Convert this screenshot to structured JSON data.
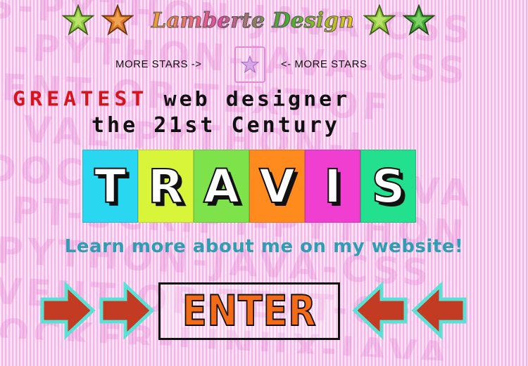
{
  "background": {
    "words": [
      "S-PYTHON-JAVA-CSS",
      "-PYTHON-JAVA-CSS",
      "VENT OR-TEXT-OF",
      "VAL-PYTHON-J",
      "DOCKER-LINUX-JAVA",
      "PT-SCRIPT-PYTHON"
    ]
  },
  "logo": {
    "text": "Lamberte Design",
    "star_colors": [
      "#8fc73e",
      "#d97a2a",
      "#8fc73e",
      "#4aa83a"
    ]
  },
  "more_stars": {
    "left_label": "MORE STARS ->",
    "right_label": "<- MORE STARS",
    "icon": "star-icon"
  },
  "tagline": {
    "highlight": "GREATEST",
    "line1_rest": " web designer",
    "line2": "the 21st Century"
  },
  "name_tiles": [
    {
      "letter": "T",
      "bg": "#29d8f0"
    },
    {
      "letter": "R",
      "bg": "#d8f53a"
    },
    {
      "letter": "A",
      "bg": "#7ee24a"
    },
    {
      "letter": "V",
      "bg": "#ff8a1e"
    },
    {
      "letter": "I",
      "bg": "#f03fd0"
    },
    {
      "letter": "S",
      "bg": "#22e08e"
    }
  ],
  "learn_more": "Learn more about me on my website!",
  "enter": {
    "label": "ENTER",
    "arrow_color": "#c23b22",
    "arrow_outline": "#5de0d4"
  }
}
